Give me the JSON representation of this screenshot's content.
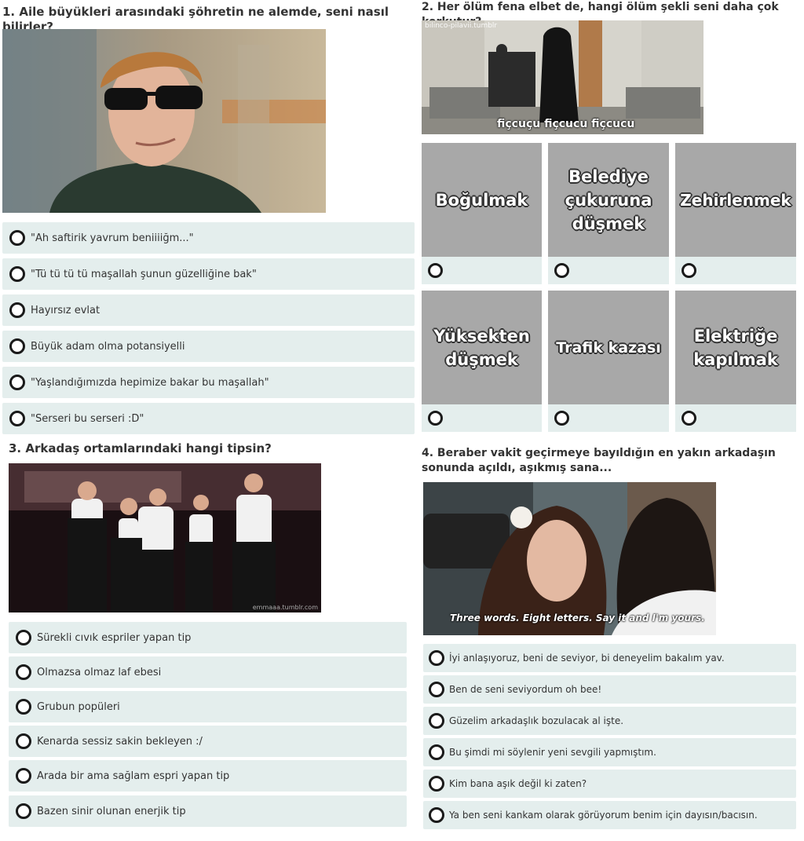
{
  "q1": {
    "title": "1. Aile büyükleri arasındaki şöhretin ne alemde, seni nasıl bilirler?",
    "options": [
      "\"Ah saftirik yavrum beniiiiğm...\"",
      "\"Tü tü tü tü maşallah şunun güzelliğine bak\"",
      "Hayırsız evlat",
      "Büyük adam olma potansiyelli",
      "\"Yaşlandığımızda hepimize bakar bu maşallah\"",
      "\"Serseri bu serseri :D\""
    ]
  },
  "q2": {
    "title": "2. Her ölüm fena elbet de, hangi ölüm şekli seni daha çok korkutur?",
    "image_watermark": "bilinco-pilavii.tumblr",
    "image_caption": "fiçcuçu fiçcucu fiçcucu",
    "tiles": [
      "Boğulmak",
      "Belediye çukuruna düşmek",
      "Zehirlenmek",
      "Yüksekten düşmek",
      "Trafik kazası",
      "Elektriğe kapılmak"
    ]
  },
  "q3": {
    "title": "3. Arkadaş ortamlarındaki hangi tipsin?",
    "image_watermark": "emmaaa.tumblr.com",
    "options": [
      "Sürekli cıvık espriler yapan tip",
      "Olmazsa olmaz laf ebesi",
      "Grubun popüleri",
      "Kenarda sessiz sakin bekleyen :/",
      "Arada bir ama sağlam espri yapan tip",
      "Bazen sinir olunan enerjik tip"
    ]
  },
  "q4": {
    "title": "4. Beraber vakit geçirmeye bayıldığın en yakın arkadaşın sonunda açıldı, aşıkmış sana...",
    "image_caption": "Three words. Eight letters. Say it and I'm yours.",
    "options": [
      "İyi anlaşıyoruz, beni de seviyor, bi deneyelim bakalım yav.",
      "Ben de seni seviyordum oh bee!",
      "Güzelim arkadaşlık bozulacak al işte.",
      "Bu şimdi mi söylenir yeni sevgili yapmıştım.",
      "Kim bana aşık değil ki zaten?",
      "Ya ben seni kankam olarak görüyorum benim için dayısın/bacısın."
    ]
  },
  "colors": {
    "option_bg": "#e4eeed",
    "tile_bg": "#a8a8a8",
    "radio_border": "#1a1a1a"
  }
}
